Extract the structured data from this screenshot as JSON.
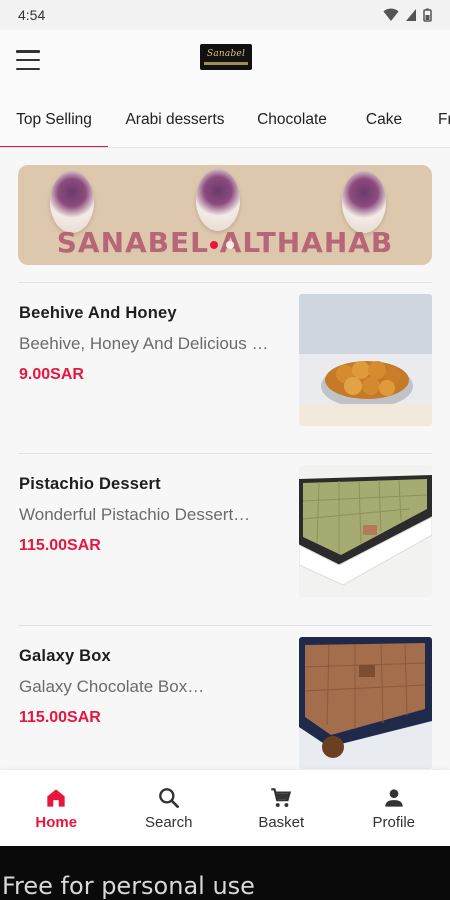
{
  "status_bar": {
    "time": "4:54"
  },
  "app_bar": {
    "logo_text": "Sanabel"
  },
  "tabs": [
    {
      "label": "Top Selling",
      "active": true
    },
    {
      "label": "Arabi desserts",
      "active": false
    },
    {
      "label": "Chocolate",
      "active": false
    },
    {
      "label": "Cake",
      "active": false
    },
    {
      "label": "Fr",
      "active": false
    }
  ],
  "banner": {
    "title": "SANABEL ALTHAHAB",
    "active_slide": 1,
    "slide_count": 2
  },
  "products": [
    {
      "name": "Beehive And Honey",
      "description": "Beehive, Honey And Delicious …",
      "price": "9.00SAR"
    },
    {
      "name": "Pistachio Dessert",
      "description": "Wonderful Pistachio Dessert…",
      "price": "115.00SAR"
    },
    {
      "name": "Galaxy Box",
      "description": "Galaxy Chocolate Box…",
      "price": "115.00SAR"
    }
  ],
  "bottom_nav": [
    {
      "label": "Home",
      "icon": "home-icon",
      "active": true
    },
    {
      "label": "Search",
      "icon": "search-icon",
      "active": false
    },
    {
      "label": "Basket",
      "icon": "cart-icon",
      "active": false
    },
    {
      "label": "Profile",
      "icon": "person-icon",
      "active": false
    }
  ],
  "watermark": "Free for personal use",
  "colors": {
    "accent": "#e8163c",
    "banner_bg": "#ddc8ad",
    "price": "#e8163c"
  }
}
